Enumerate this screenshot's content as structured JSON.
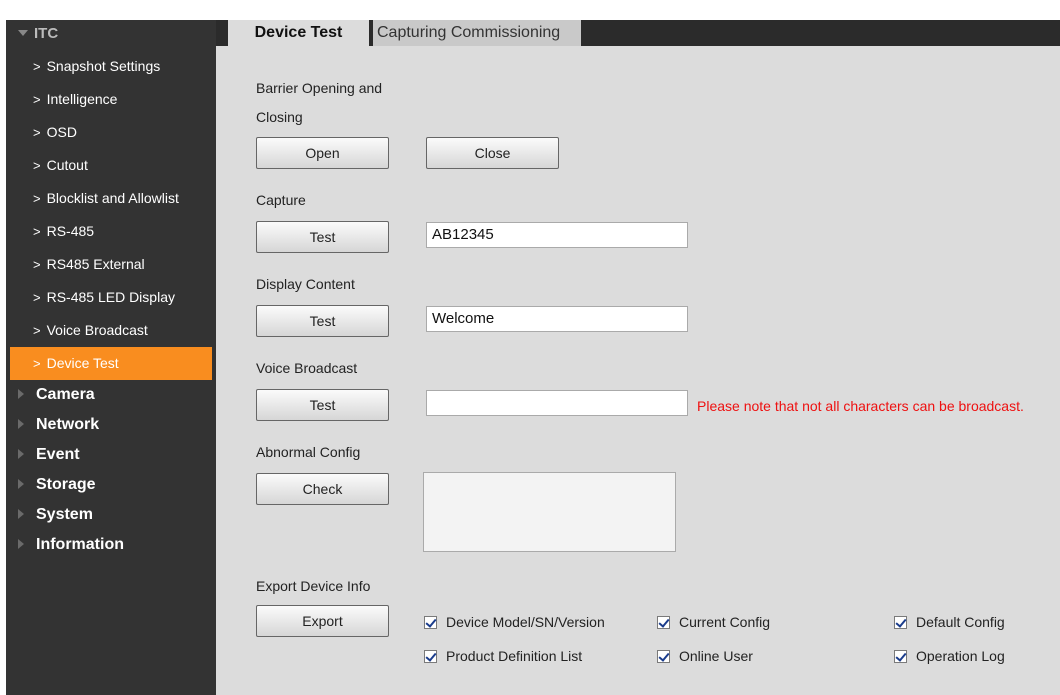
{
  "sidebar": {
    "header": "ITC",
    "items": [
      {
        "label": "Snapshot Settings"
      },
      {
        "label": "Intelligence"
      },
      {
        "label": "OSD"
      },
      {
        "label": "Cutout"
      },
      {
        "label": "Blocklist and Allowlist"
      },
      {
        "label": "RS-485"
      },
      {
        "label": "RS485 External"
      },
      {
        "label": "RS-485 LED Display"
      },
      {
        "label": "Voice Broadcast"
      },
      {
        "label": "Device Test",
        "active": true
      }
    ],
    "sections": [
      "Camera",
      "Network",
      "Event",
      "Storage",
      "System",
      "Information"
    ]
  },
  "tabs": [
    {
      "label": "Device Test",
      "active": true
    },
    {
      "label": "Capturing Commissioning",
      "active": false
    }
  ],
  "main": {
    "barrier": {
      "label_line1": "Barrier Opening and",
      "label_line2": "Closing",
      "open_label": "Open",
      "close_label": "Close"
    },
    "capture": {
      "label": "Capture",
      "button_label": "Test",
      "value": "AB12345"
    },
    "display_content": {
      "label": "Display Content",
      "button_label": "Test",
      "value": "Welcome"
    },
    "voice_broadcast": {
      "label": "Voice Broadcast",
      "button_label": "Test",
      "value": "",
      "note": "Please note that not all characters can be broadcast."
    },
    "abnormal_config": {
      "label": "Abnormal Config",
      "button_label": "Check"
    },
    "export": {
      "label": "Export Device Info",
      "button_label": "Export",
      "options": [
        {
          "label": "Device Model/SN/Version",
          "checked": true
        },
        {
          "label": "Current Config",
          "checked": true
        },
        {
          "label": "Default Config",
          "checked": true
        },
        {
          "label": "Product Definition List",
          "checked": true
        },
        {
          "label": "Online User",
          "checked": true
        },
        {
          "label": "Operation Log",
          "checked": true
        }
      ]
    }
  },
  "colors": {
    "sidebar_bg": "#333333",
    "active_item": "#f98d1f",
    "content_bg": "#dcdcdc",
    "warning": "#ee1111"
  }
}
